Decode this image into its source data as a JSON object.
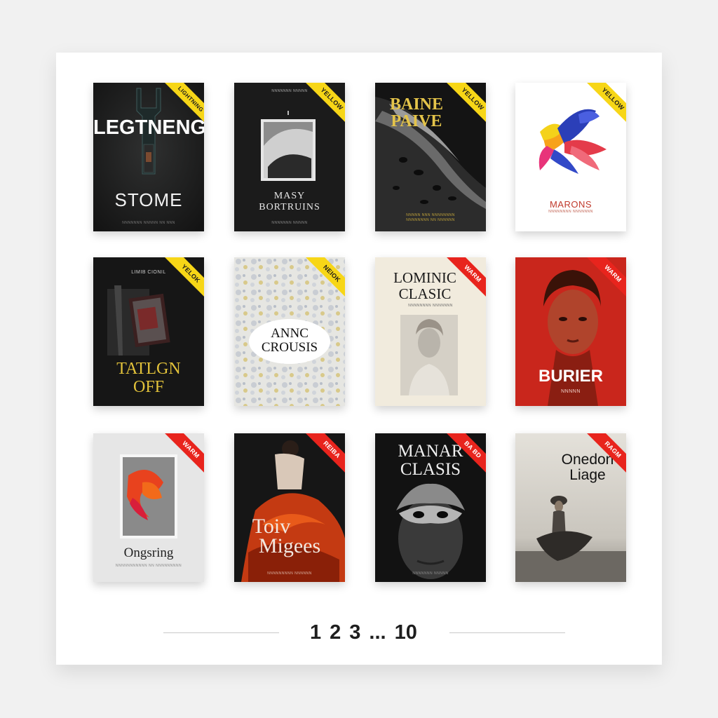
{
  "books": [
    {
      "badge": "LIGHTNING",
      "badge_style": "yellow",
      "title_line1": "LEGTNENG",
      "title_line2": "STOME",
      "subtitle": "NNNNNNN NNNNN NN NNN"
    },
    {
      "badge": "YELLOW",
      "badge_style": "yellow",
      "title_line1": "MASY",
      "title_line2": "BORTRUINS",
      "top_text": "NNNNNNN NNNNN",
      "subtitle": "NNNNNNN NNNNN"
    },
    {
      "badge": "YELLOW",
      "badge_style": "yellow",
      "title_line1": "BAINE",
      "title_line2": "PAIVE",
      "subtitle": "NNNNN NNN NNNNNNNN",
      "subtitle2": "NNNNNNNN NN NNNNNN"
    },
    {
      "badge": "YELLOW",
      "badge_style": "yellow",
      "title_line1": "MARONS",
      "subtitle": "NNNNNNNN NNNNNNN"
    },
    {
      "badge": "YELOK",
      "badge_style": "yellow",
      "top_text": "LIMIB CIONIL",
      "title_line1": "TATLGN",
      "title_line2": "OFF"
    },
    {
      "badge": "NEIOK",
      "badge_style": "yellow",
      "title_line1": "ANNC",
      "title_line2": "CROUSIS"
    },
    {
      "badge": "WARM",
      "badge_style": "warm",
      "title_line1": "LOMINIC",
      "title_line2": "CLASIC",
      "subtitle": "NNNNNNNN NNNNNNN"
    },
    {
      "badge": "WARM",
      "badge_style": "warm",
      "title_line1": "BURIER",
      "subtitle": "NNNNN"
    },
    {
      "badge": "WARM",
      "badge_style": "warm",
      "title_line1": "Ongsring",
      "subtitle": "NNNNNNNNNNN NN NNNNNNNNN"
    },
    {
      "badge": "REIBA",
      "badge_style": "warm",
      "title_line1": "Toiv",
      "title_line2": "Migees",
      "subtitle": "NNNNNNNNN NNNNNN"
    },
    {
      "badge": "BA BD",
      "badge_style": "warm",
      "title_line1": "MANAR",
      "title_line2": "CLASIS",
      "subtitle": "NNNNNNN NNNNN"
    },
    {
      "badge": "RAGM",
      "badge_style": "warm",
      "title_line1": "Onedon",
      "title_line2": "Liage"
    }
  ],
  "pagination": {
    "page1": "1",
    "page2": "2",
    "page3": "3",
    "ellipsis": "...",
    "last": "10"
  },
  "colors": {
    "badge_yellow": "#f7d617",
    "badge_warm": "#e8241d",
    "panel_bg": "#ffffff",
    "page_bg": "#f1f1f1"
  }
}
